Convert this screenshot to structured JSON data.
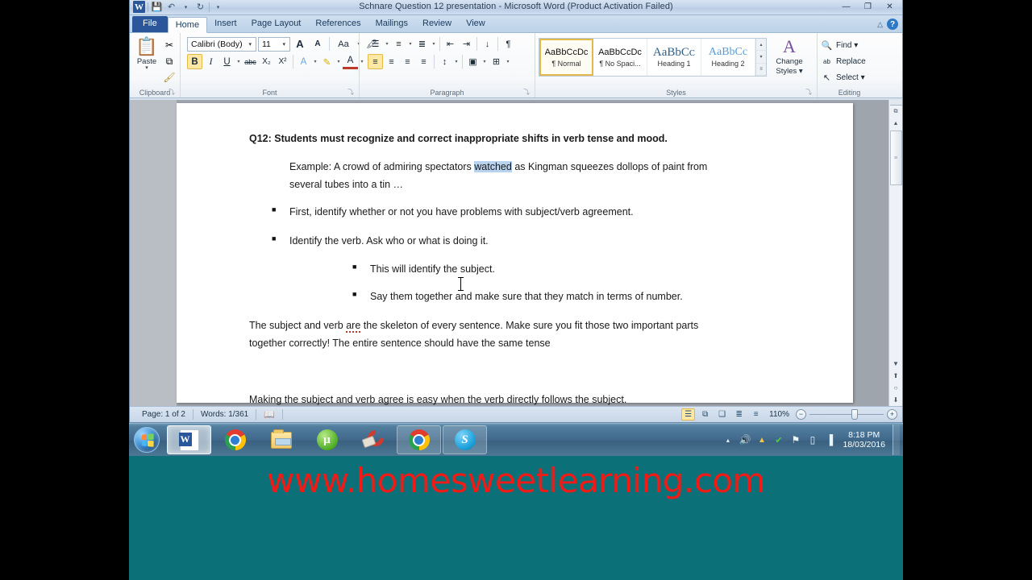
{
  "window": {
    "title": "Schnare Question 12 presentation  -  Microsoft Word (Product Activation Failed)",
    "app_logo": "W",
    "quick_access": [
      {
        "name": "save-icon",
        "glyph": "💾"
      },
      {
        "name": "undo-icon",
        "glyph": "↶"
      },
      {
        "name": "undo-dropdown-caret",
        "glyph": "▾"
      },
      {
        "name": "redo-icon",
        "glyph": "↻"
      },
      {
        "name": "customize-qat-caret",
        "glyph": "▾"
      }
    ],
    "controls": {
      "minimize": "—",
      "restore": "❐",
      "close": "✕"
    },
    "ribbon_collapse": "△",
    "help": "?"
  },
  "tabs": [
    {
      "label": "File",
      "active": false,
      "file": true
    },
    {
      "label": "Home",
      "active": true
    },
    {
      "label": "Insert",
      "active": false
    },
    {
      "label": "Page Layout",
      "active": false
    },
    {
      "label": "References",
      "active": false
    },
    {
      "label": "Mailings",
      "active": false
    },
    {
      "label": "Review",
      "active": false
    },
    {
      "label": "View",
      "active": false
    }
  ],
  "ribbon": {
    "clipboard": {
      "label": "Clipboard",
      "paste_label": "Paste",
      "paste_caret": "▾",
      "paste_icon": "📋",
      "cut_icon": "✂",
      "copy_icon": "⧉",
      "format_painter_icon": "🖌",
      "dialog_launcher": "⤵"
    },
    "font": {
      "label": "Font",
      "font_name": "Calibri (Body)",
      "font_size": "11",
      "grow_font": "A",
      "shrink_font": "A",
      "change_case": "Aa",
      "clear_formatting": "🖍",
      "bold": "B",
      "italic": "I",
      "underline": "U",
      "strikethrough": "abc",
      "subscript": "X₂",
      "superscript": "X²",
      "text_effects": "A",
      "highlight": "✎",
      "font_color": "A",
      "caret": "▾",
      "dialog_launcher": "⤵"
    },
    "paragraph": {
      "label": "Paragraph",
      "bullets": "☰",
      "numbering": "≡",
      "multilevel": "≣",
      "decrease_indent": "⇤",
      "increase_indent": "⇥",
      "sort": "↓",
      "show_marks": "¶",
      "align_left": "≡",
      "align_center": "≡",
      "align_right": "≡",
      "justify": "≡",
      "line_spacing": "↕",
      "shading": "▣",
      "borders": "⊞",
      "caret": "▾",
      "dialog_launcher": "⤵"
    },
    "styles": {
      "label": "Styles",
      "items": [
        {
          "sample": "AaBbCcDc",
          "name": "¶ Normal",
          "selected": true
        },
        {
          "sample": "AaBbCcDc",
          "name": "¶ No Spaci...",
          "selected": false
        },
        {
          "sample": "AaBbCᴄ",
          "name": "Heading 1",
          "selected": false
        },
        {
          "sample": "AaBbCc",
          "name": "Heading 2",
          "selected": false
        }
      ],
      "scroll_up": "▴",
      "scroll_down": "▾",
      "more": "≡",
      "change_styles_label": "Change",
      "change_styles_label2": "Styles ▾",
      "dialog_launcher": "⤵"
    },
    "editing": {
      "label": "Editing",
      "find": "Find ▾",
      "replace": "Replace",
      "select": "Select ▾",
      "find_icon": "🔍",
      "replace_icon": "ab",
      "select_icon": "↖"
    }
  },
  "document": {
    "heading": "Q12: Students must recognize and correct inappropriate shifts in verb tense and mood.",
    "example": {
      "before": "Example: A crowd of admiring spectators ",
      "highlighted": "watched",
      "after": " as Kingman squeezes dollops of paint from",
      "line2": "several tubes into a tin …"
    },
    "bullets": [
      {
        "text": "First, identify whether or not you have problems with subject/verb agreement.",
        "level": 1
      },
      {
        "text": "Identify the verb.  Ask who or what is doing it.",
        "level": 1
      },
      {
        "text": "This will identify the subject.",
        "level": 2
      },
      {
        "text": "Say them together and make sure that they match in terms of number.",
        "level": 2
      }
    ],
    "paragraph": {
      "line1_a": "The subject and verb ",
      "line1_spell": "are",
      "line1_b": " the skeleton of every sentence.  Make sure you fit those two important parts",
      "line2": "together correctly! The entire sentence should have the same tense"
    },
    "last_line": "Making the subject and verb agree is easy when the verb directly follows the subject.",
    "bullet_glyph": "■"
  },
  "scrollbar": {
    "split_handle": "═",
    "up_arrow": "▲",
    "thumb_grip": "≡",
    "prev_page": "▼",
    "browse_up": "⬆",
    "select_object": "○",
    "next_page": "⬇",
    "ruler_toggle": "⧉"
  },
  "status_bar": {
    "page": "Page: 1 of 2",
    "words": "Words: 1/361",
    "proofing_icon": "📖",
    "views": [
      {
        "name": "print-layout",
        "glyph": "☰",
        "active": true
      },
      {
        "name": "full-screen-reading",
        "glyph": "⧉",
        "active": false
      },
      {
        "name": "web-layout",
        "glyph": "❑",
        "active": false
      },
      {
        "name": "outline",
        "glyph": "≣",
        "active": false
      },
      {
        "name": "draft",
        "glyph": "≡",
        "active": false
      }
    ],
    "zoom": "110%",
    "zoom_out": "−",
    "zoom_in": "+"
  },
  "taskbar": {
    "start": "start-orb",
    "items": [
      {
        "name": "taskbar-item-word",
        "icon": "word-icon",
        "state": "active"
      },
      {
        "name": "taskbar-item-chrome-1",
        "icon": "chrome-icon",
        "state": "normal"
      },
      {
        "name": "taskbar-item-file-explorer",
        "icon": "folder-icon",
        "state": "normal"
      },
      {
        "name": "taskbar-item-utorrent",
        "icon": "utorrent-icon",
        "state": "normal",
        "glyph": "µ"
      },
      {
        "name": "taskbar-item-ccleaner",
        "icon": "ccleaner-icon",
        "state": "normal"
      },
      {
        "name": "taskbar-item-chrome-2",
        "icon": "chrome-icon",
        "state": "lift"
      },
      {
        "name": "taskbar-item-skype",
        "icon": "skype-icon",
        "state": "lift",
        "glyph": "S"
      }
    ],
    "tray": [
      {
        "name": "show-hidden-icons",
        "glyph": "▴"
      },
      {
        "name": "volume-icon",
        "glyph": "🔊"
      },
      {
        "name": "google-drive-icon",
        "glyph": "▲"
      },
      {
        "name": "antivirus-icon",
        "glyph": "✔"
      },
      {
        "name": "action-center-flag-icon",
        "glyph": "⚑"
      },
      {
        "name": "battery-icon",
        "glyph": "▯"
      },
      {
        "name": "network-signal-icon",
        "glyph": "▐"
      }
    ],
    "clock_time": "8:18 PM",
    "clock_date": "18/03/2016"
  },
  "watermark": {
    "text": "www.homesweetlearning.com"
  },
  "colors": {
    "word_blue": "#2b579a",
    "teal_background": "#0b7078",
    "watermark_red": "#f01b16",
    "selection_blue": "#b9d3ee",
    "accent_gold": "#ffe8a3"
  }
}
